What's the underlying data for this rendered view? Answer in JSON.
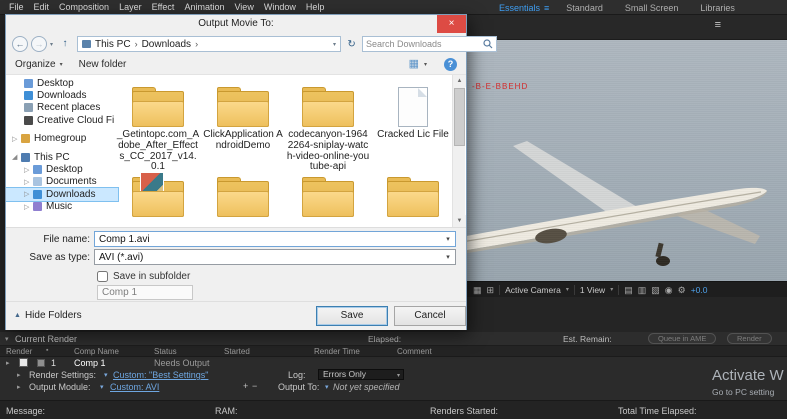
{
  "colors": {
    "accent_blue": "#3e9df0",
    "link_blue": "#6ea6e0",
    "folder_yellow": "#eec05d",
    "close_red": "#dd4b44",
    "watermark_red": "#d22c2c"
  },
  "menubar": {
    "items": [
      "File",
      "Edit",
      "Composition",
      "Layer",
      "Effect",
      "Animation",
      "View",
      "Window",
      "Help"
    ]
  },
  "workspaces": {
    "active": "Essentials",
    "items": [
      "Essentials",
      "Standard",
      "Small Screen",
      "Libraries"
    ]
  },
  "dialog": {
    "title": "Output Movie To:",
    "breadcrumb": {
      "root": "This PC",
      "folder": "Downloads"
    },
    "search": {
      "placeholder": "Search Downloads"
    },
    "toolbar": {
      "organize": "Organize",
      "new_folder": "New folder"
    },
    "tree": {
      "items": [
        {
          "label": "Desktop"
        },
        {
          "label": "Downloads"
        },
        {
          "label": "Recent places"
        },
        {
          "label": "Creative Cloud Fi"
        },
        {
          "label": "Homegroup"
        },
        {
          "label": "This PC"
        },
        {
          "label": "Desktop"
        },
        {
          "label": "Documents"
        },
        {
          "label": "Downloads",
          "selected": true
        },
        {
          "label": "Music"
        }
      ]
    },
    "files": [
      {
        "name": "_Getintopc.com_Adobe_After_Effects_CC_2017_v14.0.1",
        "type": "folder"
      },
      {
        "name": "ClickApplication AndroidDemo",
        "type": "folder"
      },
      {
        "name": "codecanyon-19642264-sniplay-watch-video-online-youtube-api",
        "type": "folder"
      },
      {
        "name": "Cracked Lic File",
        "type": "file"
      }
    ],
    "fields": {
      "file_name_label": "File name:",
      "file_name_value": "Comp 1.avi",
      "save_as_type_label": "Save as type:",
      "save_as_type_value": "AVI (*.avi)",
      "subfolder_checkbox": "Save in subfolder",
      "subfolder_name": "Comp 1"
    },
    "buttons": {
      "save": "Save",
      "cancel": "Cancel",
      "hide_folders": "Hide Folders"
    }
  },
  "viewer": {
    "watermark": "-B-E-BBEHD",
    "toolbar": {
      "camera": "Active Camera",
      "views": "1 View",
      "exposure": "+0.0"
    }
  },
  "render_queue": {
    "section_title": "Current Render",
    "elapsed": "Elapsed:",
    "est_remain": "Est. Remain:",
    "buttons": {
      "queue_ame": "Queue in AME",
      "render": "Render"
    },
    "columns": {
      "render": "Render",
      "comp_name": "Comp Name",
      "status": "Status",
      "started": "Started",
      "render_time": "Render Time",
      "comment": "Comment"
    },
    "row": {
      "index": "1",
      "comp": "Comp 1",
      "status": "Needs Output"
    },
    "render_settings": {
      "label": "Render Settings:",
      "value": "Custom: \"Best Settings\"",
      "log_label": "Log:",
      "log_value": "Errors Only"
    },
    "output_module": {
      "label": "Output Module:",
      "value": "Custom: AVI",
      "plus": "+",
      "minus": "−",
      "output_to_label": "Output To:",
      "output_to_value": "Not yet specified"
    },
    "footer": {
      "message": "Message:",
      "ram": "RAM:",
      "renders_started": "Renders Started:",
      "total_time": "Total Time Elapsed:"
    }
  },
  "activation": {
    "line1": "Activate W",
    "line2": "Go to PC setting"
  }
}
